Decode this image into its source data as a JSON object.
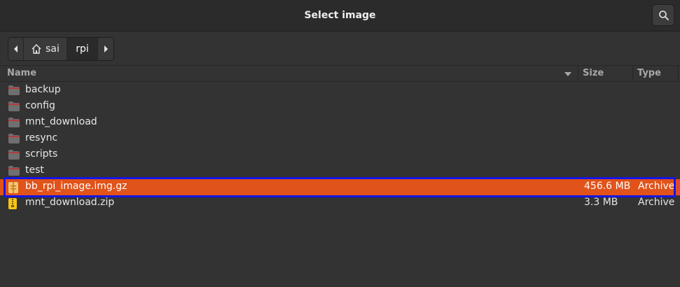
{
  "window": {
    "title": "Select image"
  },
  "pathbar": {
    "segments": [
      {
        "label": "sai",
        "icon": "home-icon"
      },
      {
        "label": "rpi"
      }
    ]
  },
  "columns": {
    "name": "Name",
    "size": "Size",
    "type": "Type"
  },
  "files": [
    {
      "name": "backup",
      "size": "",
      "type": "",
      "icon": "folder-icon"
    },
    {
      "name": "config",
      "size": "",
      "type": "",
      "icon": "folder-icon"
    },
    {
      "name": "mnt_download",
      "size": "",
      "type": "",
      "icon": "folder-icon"
    },
    {
      "name": "resync",
      "size": "",
      "type": "",
      "icon": "folder-icon"
    },
    {
      "name": "scripts",
      "size": "",
      "type": "",
      "icon": "folder-icon"
    },
    {
      "name": "test",
      "size": "",
      "type": "",
      "icon": "folder-icon"
    },
    {
      "name": "bb_rpi_image.img.gz",
      "size": "456.6 MB",
      "type": "Archive",
      "icon": "archive-icon",
      "selected": true
    },
    {
      "name": "mnt_download.zip",
      "size": "3.3 MB",
      "type": "Archive",
      "icon": "zip-archive-icon"
    }
  ],
  "colors": {
    "selection": "#e0531a",
    "highlight_box": "#1515e6",
    "background": "#333333"
  }
}
